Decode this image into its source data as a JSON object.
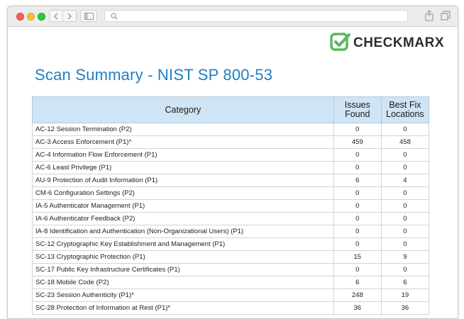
{
  "logo": {
    "text": "CHECKMARX"
  },
  "page": {
    "title": "Scan Summary - NIST SP 800-53"
  },
  "table": {
    "headers": {
      "category": "Category",
      "issues": "Issues Found",
      "best_fix": "Best Fix Locations"
    },
    "rows": [
      {
        "category": "AC-12 Session Termination (P2)",
        "issues": "0",
        "best_fix": "0"
      },
      {
        "category": "AC-3 Access Enforcement (P1)*",
        "issues": "459",
        "best_fix": "458"
      },
      {
        "category": "AC-4 Information Flow Enforcement (P1)",
        "issues": "0",
        "best_fix": "0"
      },
      {
        "category": "AC-6 Least Privilege (P1)",
        "issues": "0",
        "best_fix": "0"
      },
      {
        "category": "AU-9 Protection of Audit Information (P1)",
        "issues": "6",
        "best_fix": "4"
      },
      {
        "category": "CM-6 Configuration Settings (P2)",
        "issues": "0",
        "best_fix": "0"
      },
      {
        "category": "IA-5 Authenticator Management (P1)",
        "issues": "0",
        "best_fix": "0"
      },
      {
        "category": "IA-6 Authenticator Feedback (P2)",
        "issues": "0",
        "best_fix": "0"
      },
      {
        "category": "IA-8 Identification and Authentication (Non-Organizational Users) (P1)",
        "issues": "0",
        "best_fix": "0"
      },
      {
        "category": "SC-12 Cryptographic Key Establishment and Management (P1)",
        "issues": "0",
        "best_fix": "0"
      },
      {
        "category": "SC-13 Cryptographic Protection (P1)",
        "issues": "15",
        "best_fix": "9"
      },
      {
        "category": "SC-17 Public Key Infrastructure Certificates (P1)",
        "issues": "0",
        "best_fix": "0"
      },
      {
        "category": "SC-18 Mobile Code (P2)",
        "issues": "6",
        "best_fix": "6"
      },
      {
        "category": "SC-23 Session Authenticity (P1)*",
        "issues": "248",
        "best_fix": "19"
      },
      {
        "category": "SC-28 Protection of Information at Rest (P1)*",
        "issues": "36",
        "best_fix": "36"
      }
    ]
  },
  "icons": {
    "back": "chevron-left-icon",
    "forward": "chevron-right-icon",
    "sidebar": "sidebar-icon",
    "search": "search-icon",
    "share": "share-icon",
    "tabs": "tabs-icon"
  },
  "colors": {
    "title": "#1f7fc3",
    "header_bg": "#cfe4f4",
    "logo_green": "#5cb85c"
  }
}
